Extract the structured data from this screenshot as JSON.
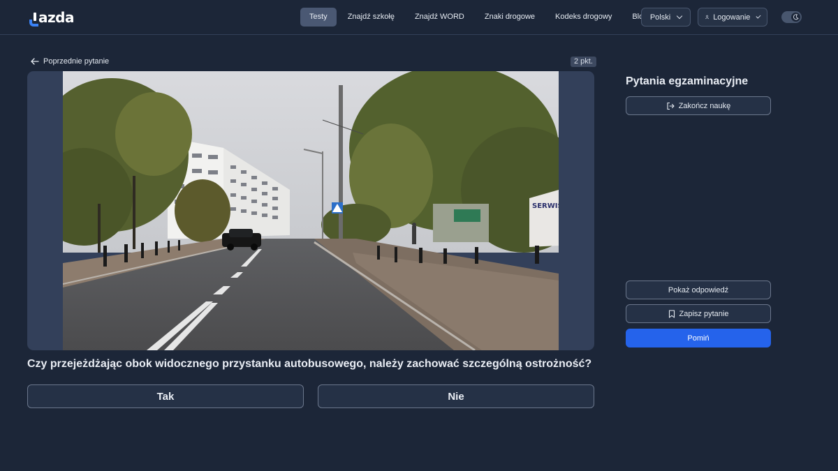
{
  "header": {
    "logo_text": "azda",
    "nav": [
      {
        "label": "Testy",
        "active": true
      },
      {
        "label": "Znajdź szkołę",
        "active": false
      },
      {
        "label": "Znajdź WORD",
        "active": false
      },
      {
        "label": "Znaki drogowe",
        "active": false
      },
      {
        "label": "Kodeks drogowy",
        "active": false
      },
      {
        "label": "Blog",
        "active": false
      }
    ],
    "language": "Polski",
    "login": "Logowanie"
  },
  "question": {
    "prev_link": "Poprzednie pytanie",
    "points": "2 pkt.",
    "text": "Czy przejeżdżając obok widocznego przystanku autobusowego, należy zachować szczególną ostrożność?",
    "answers": [
      "Tak",
      "Nie"
    ],
    "sign_text": "SERWIS K"
  },
  "side": {
    "title": "Pytania egzaminacyjne",
    "end_label": "Zakończ naukę",
    "show_label": "Pokaż odpowiedź",
    "save_label": "Zapisz pytanie",
    "skip_label": "Pomiń"
  },
  "colors": {
    "background": "#1c2638",
    "accent": "#2563eb",
    "active_nav": "#4a5873"
  }
}
